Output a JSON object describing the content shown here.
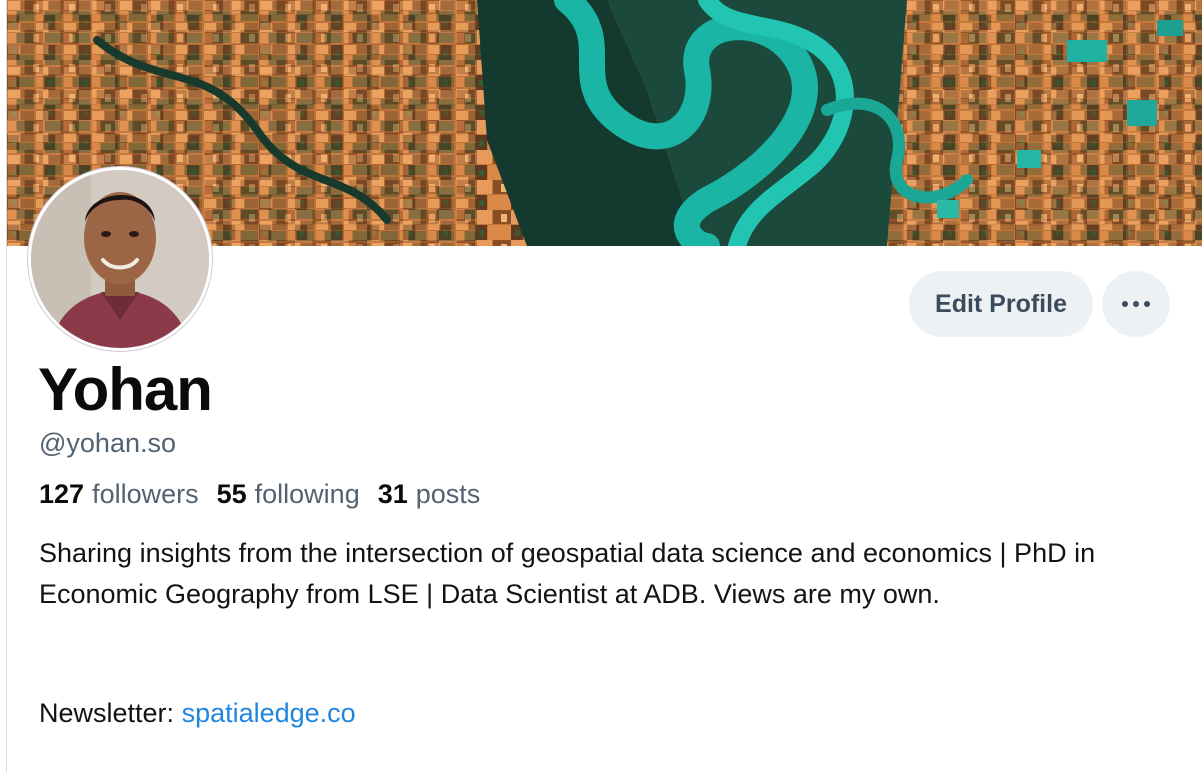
{
  "profile": {
    "display_name": "Yohan",
    "handle": "@yohan.so",
    "banner_icon": "satellite-river-banner",
    "avatar_icon": "profile-photo"
  },
  "actions": {
    "edit_profile_label": "Edit Profile",
    "more_icon": "more-horizontal-icon"
  },
  "stats": [
    {
      "count": "127",
      "label": "followers"
    },
    {
      "count": "55",
      "label": "following"
    },
    {
      "count": "31",
      "label": "posts"
    }
  ],
  "bio": {
    "text": "Sharing insights from the intersection of geospatial data science and economics | PhD in Economic Geography from LSE | Data Scientist at ADB. Views are my own.",
    "newsletter_prefix": "Newsletter:",
    "newsletter_link": "spatialedge.co"
  },
  "colors": {
    "link": "#1f86e0",
    "muted_text": "#536271",
    "button_bg": "#eef1f4",
    "button_text": "#3c4b5c"
  }
}
